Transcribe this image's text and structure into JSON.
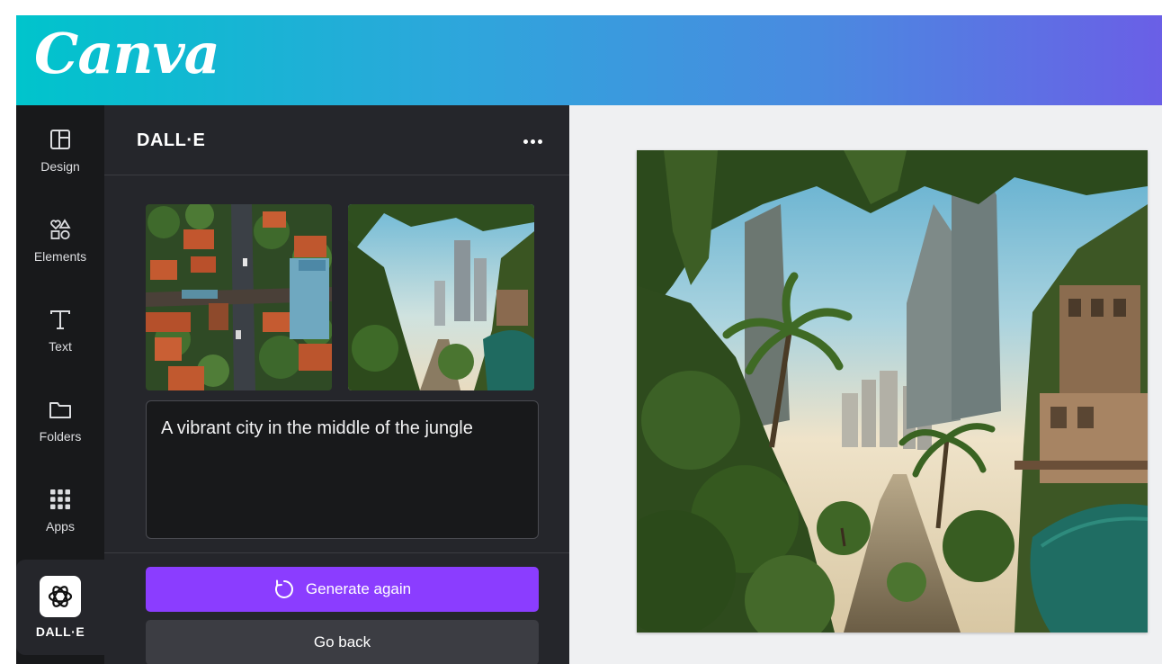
{
  "header": {
    "logo_text": "Canva",
    "gradient": [
      "#00c4cc",
      "#6a5fe6"
    ]
  },
  "sidebar": {
    "items": [
      {
        "label": "Design",
        "icon": "layout-icon"
      },
      {
        "label": "Elements",
        "icon": "shapes-icon"
      },
      {
        "label": "Text",
        "icon": "text-t-icon"
      },
      {
        "label": "Folders",
        "icon": "folder-icon"
      },
      {
        "label": "Apps",
        "icon": "apps-grid-icon"
      },
      {
        "label": "DALL·E",
        "icon": "openai-logo-icon",
        "active": true
      }
    ]
  },
  "panel": {
    "title": "DALL·E",
    "prompt": "A vibrant city in the middle of the jungle",
    "generate_again_label": "Generate again",
    "go_back_label": "Go back",
    "accent": "#8b3dff"
  },
  "images": {
    "thumbnails": [
      "aerial city with red roofs",
      "jungle city street"
    ],
    "main": "jungle city street"
  }
}
